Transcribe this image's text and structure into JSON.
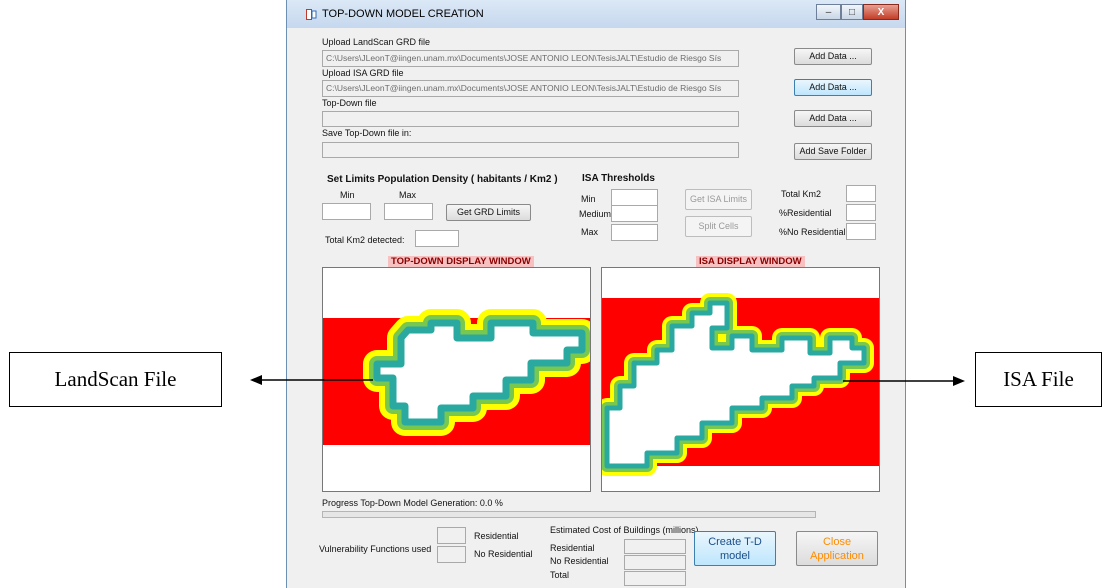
{
  "window": {
    "title": "TOP-DOWN MODEL CREATION",
    "controls": {
      "minimize": "–",
      "maximize": "□",
      "close": "X"
    }
  },
  "files": {
    "landscan": {
      "label": "Upload LandScan GRD file",
      "value": "C:\\Users\\JLeonT@iingen.unam.mx\\Documents\\JOSE ANTONIO LEON\\TesisJALT\\Estudio de Riesgo Sís",
      "button": "Add Data ..."
    },
    "isa": {
      "label": "Upload ISA GRD file",
      "value": "C:\\Users\\JLeonT@iingen.unam.mx\\Documents\\JOSE ANTONIO LEON\\TesisJALT\\Estudio de Riesgo Sís",
      "button": "Add Data ..."
    },
    "topdown": {
      "label": "Top-Down file",
      "value": "",
      "button": "Add Data ..."
    },
    "save": {
      "label": "Save Top-Down file in:",
      "value": "",
      "button": "Add Save Folder"
    }
  },
  "limits": {
    "title": "Set Limits Population Density ( habitants / Km2 )",
    "min_label": "Min",
    "max_label": "Max",
    "button": "Get GRD Limits",
    "total_label": "Total Km2 detected:"
  },
  "isa_thresholds": {
    "title": "ISA Thresholds",
    "min_label": "Min",
    "medium_label": "Medium",
    "max_label": "Max",
    "get_button": "Get ISA Limits",
    "split_button": "Split Cells"
  },
  "totals": {
    "total_km2": "Total Km2",
    "residential": "%Residential",
    "no_residential": "%No Residential"
  },
  "displays": {
    "topdown_title": "TOP-DOWN DISPLAY WINDOW",
    "isa_title": "ISA DISPLAY WINDOW"
  },
  "progress": {
    "label": "Progress Top-Down Model Generation: 0.0 %",
    "value": 0.0
  },
  "vulnerability": {
    "label": "Vulnerability Functions used",
    "residential": "Residential",
    "no_residential": "No Residential"
  },
  "cost": {
    "title": "Estimated Cost of Buildings (millions)",
    "residential": "Residential",
    "no_residential": "No Residential",
    "total": "Total"
  },
  "actions": {
    "create": "Create T-D model",
    "close": "Close Application"
  },
  "annotations": {
    "left": "LandScan File",
    "right": "ISA File"
  },
  "colors": {
    "panel_red": "#ff0000",
    "edge_teal": "#2aa9a0",
    "close_text": "#ff8c00",
    "title_bg": "#f7c1c1"
  }
}
